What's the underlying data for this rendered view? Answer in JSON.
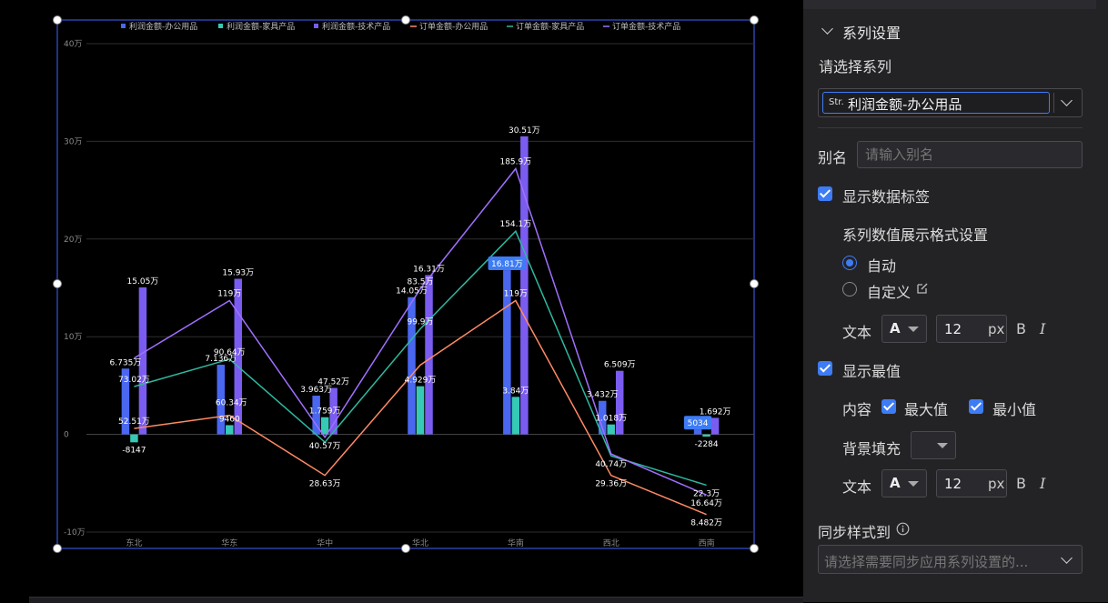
{
  "chart_data": {
    "type": "bar",
    "categories": [
      "东北",
      "华东",
      "华中",
      "华北",
      "华南",
      "西北",
      "西南"
    ],
    "legend": [
      "利润金额-办公用品",
      "利润金额-家具产品",
      "利润金额-技术产品",
      "订单金额-办公用品",
      "订单金额-家具产品",
      "订单金额-技术产品"
    ],
    "legend_position": "top",
    "grid": true,
    "ylim": [
      -100000,
      400000
    ],
    "y_ticks": [
      400000,
      300000,
      200000,
      100000,
      0,
      -100000
    ],
    "y_tick_labels": [
      "40万",
      "30万",
      "20万",
      "10万",
      "0",
      "-10万"
    ],
    "series": [
      {
        "name": "利润金额-办公用品",
        "type": "bar",
        "color": "#4a67f0",
        "values": [
          67350,
          71360,
          39630,
          140500,
          168100,
          34320,
          5034
        ],
        "labels": [
          "6.735万",
          "7.136万",
          "3.963万",
          "14.05万",
          "16.81万",
          "3.432万",
          "5034"
        ]
      },
      {
        "name": "利润金额-家具产品",
        "type": "bar",
        "color": "#36c9b6",
        "values": [
          -8147,
          9460,
          17590,
          49290,
          38400,
          10180,
          -2284
        ],
        "labels": [
          "-8147",
          "9460",
          "1.759万",
          "4.929万",
          "3.84万",
          "1.018万",
          "-2284"
        ]
      },
      {
        "name": "利润金额-技术产品",
        "type": "bar",
        "color": "#7b5cf0",
        "values": [
          150500,
          159300,
          47520,
          163100,
          305100,
          65090,
          16920
        ],
        "labels": [
          "15.05万",
          "15.93万",
          "47.52万",
          "16.31万",
          "30.51万",
          "6.509万",
          "1.692万"
        ]
      },
      {
        "name": "订单金额-办公用品",
        "type": "line",
        "color": "#ff8a65",
        "values": [
          6000,
          19500,
          -42000,
          71000,
          137000,
          -42000,
          -82000
        ],
        "labels": [
          "52.51万",
          "",
          "28.63万",
          "",
          "119万",
          "29.36万",
          "8.482万"
        ]
      },
      {
        "name": "订单金额-家具产品",
        "type": "line",
        "color": "#2fb8a0",
        "values": [
          49000,
          77000,
          -8000,
          108000,
          208000,
          -22000,
          -52000
        ],
        "labels": [
          "73.02万",
          "90.64万",
          "",
          "99.9万",
          "154.1万",
          "40.74万",
          "22.3万"
        ]
      },
      {
        "name": "订单金额-技术产品",
        "type": "line",
        "color": "#a070ff",
        "values": [
          78000,
          137000,
          -3000,
          149000,
          272000,
          -20000,
          -62000
        ],
        "labels": [
          "",
          "119万",
          "40.57万",
          "83.5万",
          "185.9万",
          "",
          "16.64万"
        ]
      }
    ],
    "extra_labels": [
      "60.34万"
    ],
    "highlight_labels": [
      "16.81万",
      "5034"
    ]
  },
  "panel": {
    "section_title": "系列设置",
    "select_series_label": "请选择系列",
    "series_select": {
      "tag": "Str.",
      "value": "利润金额-办公用品"
    },
    "alias_label": "别名",
    "alias_placeholder": "请输入别名",
    "show_data_label": "显示数据标签",
    "format_title": "系列数值展示格式设置",
    "auto_label": "自动",
    "custom_label": "自定义",
    "text_label_1": "文本",
    "font_letter": "A",
    "font_size_1": "12",
    "px_unit_1": "px",
    "bold_label_1": "B",
    "italic_label_1": "I",
    "show_extreme": "显示最值",
    "content_label": "内容",
    "max_label": "最大值",
    "min_label": "最小值",
    "bg_fill_label": "背景填充",
    "text_label_2": "文本",
    "font_size_2": "12",
    "px_unit_2": "px",
    "bold_label_2": "B",
    "italic_label_2": "I",
    "sync_label": "同步样式到",
    "sync_placeholder": "请选择需要同步应用系列设置的..."
  }
}
